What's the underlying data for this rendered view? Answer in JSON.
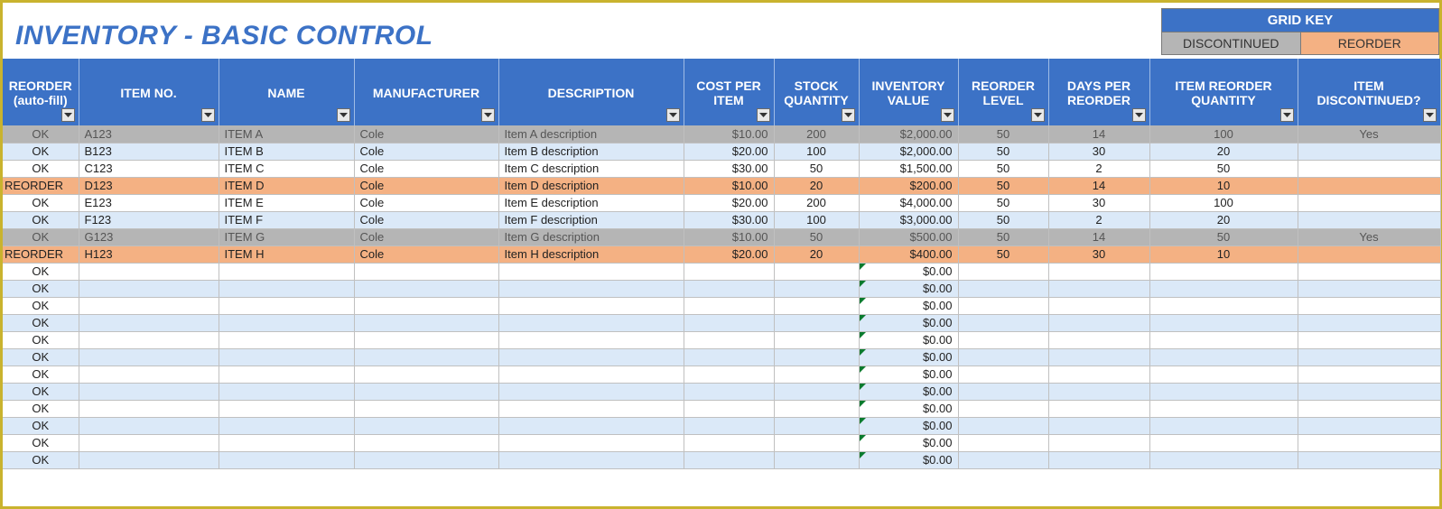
{
  "title": "INVENTORY - BASIC CONTROL",
  "gridkey": {
    "heading": "GRID KEY",
    "discontinued": "DISCONTINUED",
    "reorder": "REORDER"
  },
  "columns": [
    "REORDER (auto-fill)",
    "ITEM NO.",
    "NAME",
    "MANUFACTURER",
    "DESCRIPTION",
    "COST PER ITEM",
    "STOCK QUANTITY",
    "INVENTORY VALUE",
    "REORDER LEVEL",
    "DAYS PER REORDER",
    "ITEM REORDER QUANTITY",
    "ITEM DISCONTINUED?"
  ],
  "rows": [
    {
      "status": "OK",
      "itemno": "A123",
      "name": "ITEM A",
      "manuf": "Cole",
      "desc": "Item A description",
      "cost": "$10.00",
      "stock": "200",
      "inv": "$2,000.00",
      "rlevel": "50",
      "days": "14",
      "rqty": "100",
      "disc": "Yes",
      "cls": "grey"
    },
    {
      "status": "OK",
      "itemno": "B123",
      "name": "ITEM B",
      "manuf": "Cole",
      "desc": "Item B description",
      "cost": "$20.00",
      "stock": "100",
      "inv": "$2,000.00",
      "rlevel": "50",
      "days": "30",
      "rqty": "20",
      "disc": "",
      "cls": "band"
    },
    {
      "status": "OK",
      "itemno": "C123",
      "name": "ITEM C",
      "manuf": "Cole",
      "desc": "Item C description",
      "cost": "$30.00",
      "stock": "50",
      "inv": "$1,500.00",
      "rlevel": "50",
      "days": "2",
      "rqty": "50",
      "disc": "",
      "cls": "plain"
    },
    {
      "status": "REORDER",
      "itemno": "D123",
      "name": "ITEM D",
      "manuf": "Cole",
      "desc": "Item D description",
      "cost": "$10.00",
      "stock": "20",
      "inv": "$200.00",
      "rlevel": "50",
      "days": "14",
      "rqty": "10",
      "disc": "",
      "cls": "orange"
    },
    {
      "status": "OK",
      "itemno": "E123",
      "name": "ITEM E",
      "manuf": "Cole",
      "desc": "Item E description",
      "cost": "$20.00",
      "stock": "200",
      "inv": "$4,000.00",
      "rlevel": "50",
      "days": "30",
      "rqty": "100",
      "disc": "",
      "cls": "plain"
    },
    {
      "status": "OK",
      "itemno": "F123",
      "name": "ITEM F",
      "manuf": "Cole",
      "desc": "Item F description",
      "cost": "$30.00",
      "stock": "100",
      "inv": "$3,000.00",
      "rlevel": "50",
      "days": "2",
      "rqty": "20",
      "disc": "",
      "cls": "band"
    },
    {
      "status": "OK",
      "itemno": "G123",
      "name": "ITEM G",
      "manuf": "Cole",
      "desc": "Item G description",
      "cost": "$10.00",
      "stock": "50",
      "inv": "$500.00",
      "rlevel": "50",
      "days": "14",
      "rqty": "50",
      "disc": "Yes",
      "cls": "grey"
    },
    {
      "status": "REORDER",
      "itemno": "H123",
      "name": "ITEM H",
      "manuf": "Cole",
      "desc": "Item H description",
      "cost": "$20.00",
      "stock": "20",
      "inv": "$400.00",
      "rlevel": "50",
      "days": "30",
      "rqty": "10",
      "disc": "",
      "cls": "orange"
    },
    {
      "status": "OK",
      "itemno": "",
      "name": "",
      "manuf": "",
      "desc": "",
      "cost": "",
      "stock": "",
      "inv": "$0.00",
      "rlevel": "",
      "days": "",
      "rqty": "",
      "disc": "",
      "cls": "plain",
      "err": true
    },
    {
      "status": "OK",
      "itemno": "",
      "name": "",
      "manuf": "",
      "desc": "",
      "cost": "",
      "stock": "",
      "inv": "$0.00",
      "rlevel": "",
      "days": "",
      "rqty": "",
      "disc": "",
      "cls": "band",
      "err": true
    },
    {
      "status": "OK",
      "itemno": "",
      "name": "",
      "manuf": "",
      "desc": "",
      "cost": "",
      "stock": "",
      "inv": "$0.00",
      "rlevel": "",
      "days": "",
      "rqty": "",
      "disc": "",
      "cls": "plain",
      "err": true
    },
    {
      "status": "OK",
      "itemno": "",
      "name": "",
      "manuf": "",
      "desc": "",
      "cost": "",
      "stock": "",
      "inv": "$0.00",
      "rlevel": "",
      "days": "",
      "rqty": "",
      "disc": "",
      "cls": "band",
      "err": true
    },
    {
      "status": "OK",
      "itemno": "",
      "name": "",
      "manuf": "",
      "desc": "",
      "cost": "",
      "stock": "",
      "inv": "$0.00",
      "rlevel": "",
      "days": "",
      "rqty": "",
      "disc": "",
      "cls": "plain",
      "err": true
    },
    {
      "status": "OK",
      "itemno": "",
      "name": "",
      "manuf": "",
      "desc": "",
      "cost": "",
      "stock": "",
      "inv": "$0.00",
      "rlevel": "",
      "days": "",
      "rqty": "",
      "disc": "",
      "cls": "band",
      "err": true
    },
    {
      "status": "OK",
      "itemno": "",
      "name": "",
      "manuf": "",
      "desc": "",
      "cost": "",
      "stock": "",
      "inv": "$0.00",
      "rlevel": "",
      "days": "",
      "rqty": "",
      "disc": "",
      "cls": "plain",
      "err": true
    },
    {
      "status": "OK",
      "itemno": "",
      "name": "",
      "manuf": "",
      "desc": "",
      "cost": "",
      "stock": "",
      "inv": "$0.00",
      "rlevel": "",
      "days": "",
      "rqty": "",
      "disc": "",
      "cls": "band",
      "err": true
    },
    {
      "status": "OK",
      "itemno": "",
      "name": "",
      "manuf": "",
      "desc": "",
      "cost": "",
      "stock": "",
      "inv": "$0.00",
      "rlevel": "",
      "days": "",
      "rqty": "",
      "disc": "",
      "cls": "plain",
      "err": true
    },
    {
      "status": "OK",
      "itemno": "",
      "name": "",
      "manuf": "",
      "desc": "",
      "cost": "",
      "stock": "",
      "inv": "$0.00",
      "rlevel": "",
      "days": "",
      "rqty": "",
      "disc": "",
      "cls": "band",
      "err": true
    },
    {
      "status": "OK",
      "itemno": "",
      "name": "",
      "manuf": "",
      "desc": "",
      "cost": "",
      "stock": "",
      "inv": "$0.00",
      "rlevel": "",
      "days": "",
      "rqty": "",
      "disc": "",
      "cls": "plain",
      "err": true
    },
    {
      "status": "OK",
      "itemno": "",
      "name": "",
      "manuf": "",
      "desc": "",
      "cost": "",
      "stock": "",
      "inv": "$0.00",
      "rlevel": "",
      "days": "",
      "rqty": "",
      "disc": "",
      "cls": "band",
      "err": true
    }
  ]
}
